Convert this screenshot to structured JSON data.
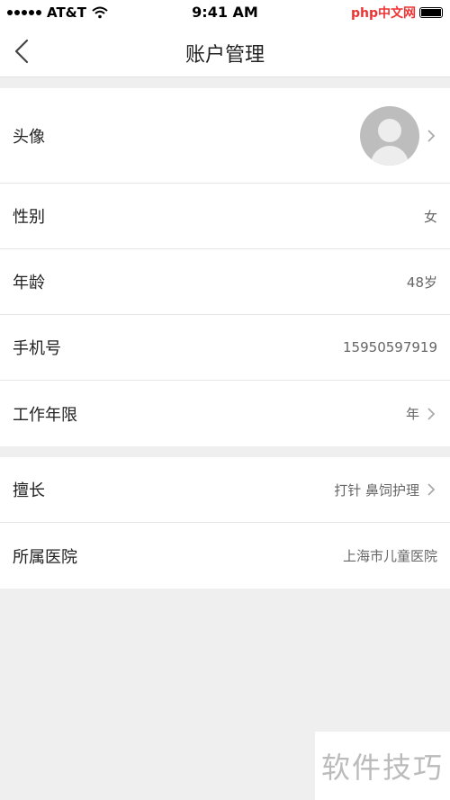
{
  "status_bar": {
    "carrier": "AT&T",
    "time": "9:41 AM",
    "watermark": "php中文网"
  },
  "nav": {
    "title": "账户管理",
    "back_icon": "chevron-left-icon"
  },
  "profile": {
    "avatar_label": "头像",
    "gender_label": "性别",
    "gender_value": "女",
    "age_label": "年龄",
    "age_value": "48岁",
    "phone_label": "手机号",
    "phone_value": "15950597919",
    "years_label": "工作年限",
    "years_value": "年"
  },
  "work": {
    "specialty_label": "擅长",
    "specialty_value": "打针 鼻饲护理",
    "hospital_label": "所属医院",
    "hospital_value": "上海市儿童医院"
  },
  "watermark_bottom": "软件技巧",
  "colors": {
    "background": "#efefef",
    "row_bg": "#ffffff",
    "text": "#222222",
    "muted": "#666666",
    "watermark": "#e33333"
  }
}
